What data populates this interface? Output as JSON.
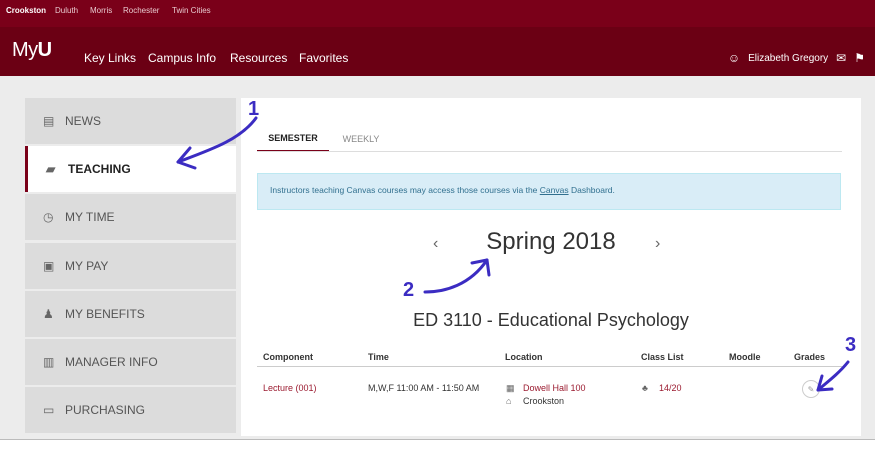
{
  "campuses": [
    "Crookston",
    "Duluth",
    "Morris",
    "Rochester",
    "Twin Cities"
  ],
  "brand": {
    "prefix": "My",
    "suffix": "U"
  },
  "nav": [
    "Key Links",
    "Campus Info",
    "Resources",
    "Favorites"
  ],
  "user": {
    "name": "Elizabeth Gregory"
  },
  "sidebar": {
    "items": [
      {
        "label": "NEWS",
        "icon": "newspaper-icon"
      },
      {
        "label": "TEACHING",
        "icon": "book-icon"
      },
      {
        "label": "MY TIME",
        "icon": "clock-icon"
      },
      {
        "label": "MY PAY",
        "icon": "money-icon"
      },
      {
        "label": "MY BENEFITS",
        "icon": "user-plus-icon"
      },
      {
        "label": "MANAGER INFO",
        "icon": "bar-chart-icon"
      },
      {
        "label": "PURCHASING",
        "icon": "credit-card-icon"
      }
    ]
  },
  "tabs": [
    "SEMESTER",
    "WEEKLY"
  ],
  "notice": {
    "before": "Instructors teaching Canvas courses may access those courses via the ",
    "link": "Canvas",
    "after": " Dashboard."
  },
  "term": "Spring 2018",
  "course": "ED 3110 - Educational Psychology",
  "table": {
    "headers": [
      "Component",
      "Time",
      "Location",
      "Class List",
      "Moodle",
      "Grades"
    ],
    "row": {
      "component": "Lecture (001)",
      "time": "M,W,F 11:00 AM - 11:50 AM",
      "building": "Dowell Hall 100",
      "campus": "Crookston",
      "class_list": "14/20"
    }
  },
  "annotations": [
    "1",
    "2",
    "3"
  ],
  "colors": {
    "maroon": "#7a0019",
    "annotation": "#3b2cc2"
  }
}
